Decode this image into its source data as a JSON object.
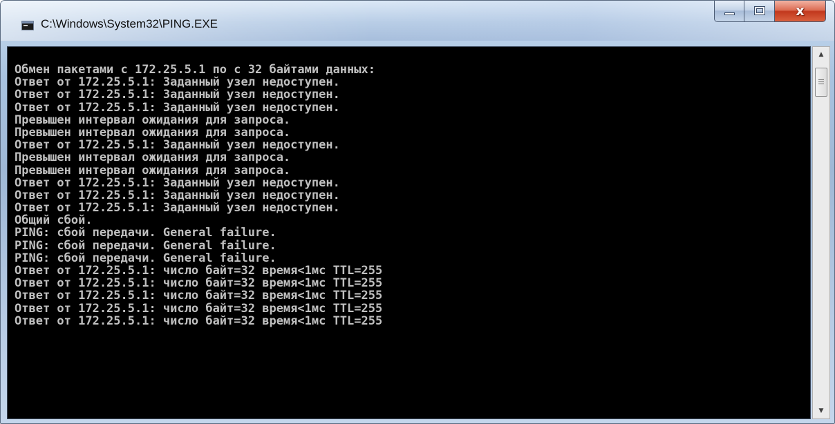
{
  "window": {
    "title": "C:\\Windows\\System32\\PING.EXE",
    "close_glyph": "x"
  },
  "console": {
    "lines": [
      "Обмен пакетами с 172.25.5.1 по с 32 байтами данных:",
      "Ответ от 172.25.5.1: Заданный узел недоступен.",
      "Ответ от 172.25.5.1: Заданный узел недоступен.",
      "Ответ от 172.25.5.1: Заданный узел недоступен.",
      "Превышен интервал ожидания для запроса.",
      "Превышен интервал ожидания для запроса.",
      "Ответ от 172.25.5.1: Заданный узел недоступен.",
      "Превышен интервал ожидания для запроса.",
      "Превышен интервал ожидания для запроса.",
      "Ответ от 172.25.5.1: Заданный узел недоступен.",
      "Ответ от 172.25.5.1: Заданный узел недоступен.",
      "Ответ от 172.25.5.1: Заданный узел недоступен.",
      "Общий сбой.",
      "PING: сбой передачи. General failure.",
      "PING: сбой передачи. General failure.",
      "PING: сбой передачи. General failure.",
      "Ответ от 172.25.5.1: число байт=32 время<1мс TTL=255",
      "Ответ от 172.25.5.1: число байт=32 время<1мс TTL=255",
      "Ответ от 172.25.5.1: число байт=32 время<1мс TTL=255",
      "Ответ от 172.25.5.1: число байт=32 время<1мс TTL=255",
      "Ответ от 172.25.5.1: число байт=32 время<1мс TTL=255"
    ],
    "text_color": "#c0c0c0",
    "background": "#000000"
  },
  "icons": {
    "app": "console-app-icon",
    "minimize": "minimize-icon",
    "maximize": "maximize-icon",
    "close": "close-icon",
    "scroll_up": "scroll-up-arrow-icon",
    "scroll_down": "scroll-down-arrow-icon"
  }
}
